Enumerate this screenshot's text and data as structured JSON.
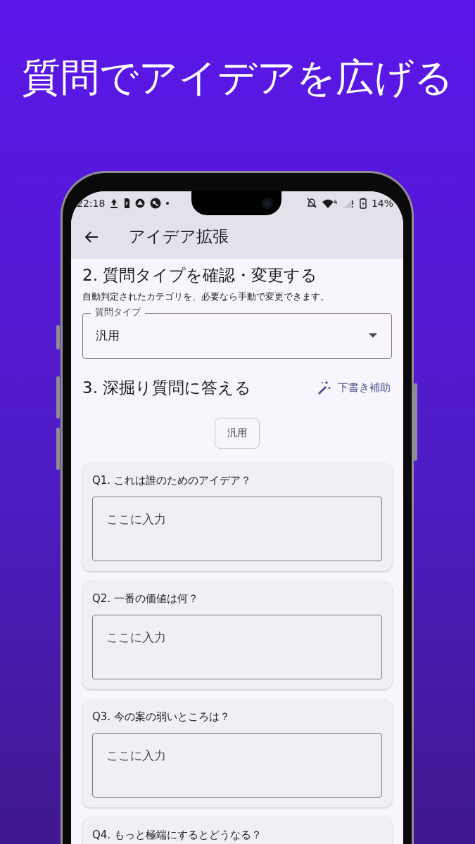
{
  "headline": "質問でアイデアを広げる",
  "status_bar": {
    "time": "22:18",
    "battery": "14%"
  },
  "app_bar": {
    "title": "アイデア拡張"
  },
  "type_section": {
    "heading": "2. 質問タイプを確認・変更する",
    "description": "自動判定されたカテゴリを、必要なら手動で変更できます。",
    "dropdown": {
      "label": "質問タイプ",
      "value": "汎用"
    }
  },
  "questions_section": {
    "heading": "3. 深掘り質問に答える",
    "assist_button": "下書き補助",
    "chip": "汎用",
    "questions": [
      {
        "label": "Q1. これは誰のためのアイデア？",
        "placeholder": "ここに入力"
      },
      {
        "label": "Q2. 一番の価値は何？",
        "placeholder": "ここに入力"
      },
      {
        "label": "Q3. 今の案の弱いところは？",
        "placeholder": "ここに入力"
      },
      {
        "label": "Q4. もっと極端にするとどうなる？"
      }
    ]
  }
}
